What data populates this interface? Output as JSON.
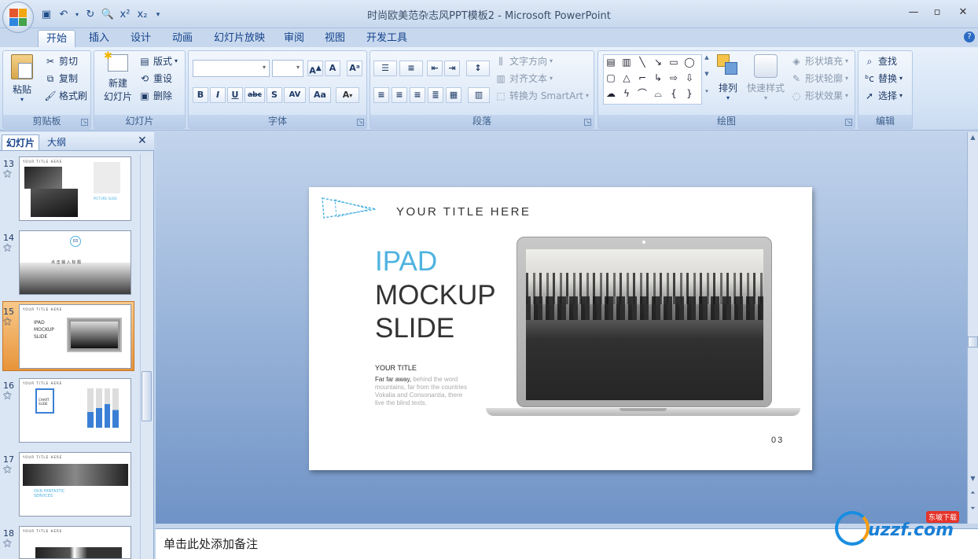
{
  "window": {
    "title": "时尚欧美范杂志风PPT模板2 - Microsoft PowerPoint"
  },
  "tabs": [
    "开始",
    "插入",
    "设计",
    "动画",
    "幻灯片放映",
    "审阅",
    "视图",
    "开发工具"
  ],
  "clipboard": {
    "paste": "粘贴",
    "cut": "剪切",
    "copy": "复制",
    "format_painter": "格式刷",
    "label": "剪贴板"
  },
  "slides_group": {
    "new_slide": "新建",
    "new_slide2": "幻灯片",
    "layout": "版式",
    "reset": "重设",
    "delete": "删除",
    "label": "幻灯片"
  },
  "font_group": {
    "label": "字体"
  },
  "paragraph_group": {
    "text_direction": "文字方向",
    "align_text": "对齐文本",
    "smartart": "转换为 SmartArt",
    "label": "段落"
  },
  "drawing_group": {
    "arrange": "排列",
    "quick_styles": "快速样式",
    "shape_fill": "形状填充",
    "shape_outline": "形状轮廓",
    "shape_effects": "形状效果",
    "label": "绘图"
  },
  "editing_group": {
    "find": "查找",
    "replace": "替换",
    "select": "选择",
    "label": "编辑"
  },
  "pane_tabs": {
    "slides": "幻灯片",
    "outline": "大纲"
  },
  "thumbnails": [
    {
      "num": "13",
      "title": "YOUR TITLE HERE",
      "caption": "PICTURE SLIDE"
    },
    {
      "num": "14",
      "title": "03",
      "caption": "点 击 输 入 标 题"
    },
    {
      "num": "15",
      "title": "YOUR TITLE HERE",
      "caption": "IPAD MOCKUP SLIDE"
    },
    {
      "num": "16",
      "title": "YOUR TITLE HERE",
      "caption": "CHART SLIDE"
    },
    {
      "num": "17",
      "title": "YOUR TITLE HERE",
      "caption": "OUR FANTASTIC SERVICES"
    },
    {
      "num": "18",
      "title": "YOUR TITLE HERE",
      "caption": ""
    }
  ],
  "slide": {
    "header": "YOUR TITLE HERE",
    "title_line1": "IPAD",
    "title_line2": "MOCKUP",
    "title_line3": "SLIDE",
    "subtitle": "YOUR TITLE",
    "body_lead": "Far far away,",
    "body_rest": " behind the word mountains, far from the countries Vokalia and Consonantia, there live the blind texts.",
    "page_number": "03"
  },
  "notes": {
    "placeholder": "单击此处添加备注"
  },
  "watermark": {
    "text": "uzzf.com",
    "sub": "东坡下载"
  },
  "colors": {
    "accent_blue": "#4fb3e0",
    "ribbon": "#dbe7f6",
    "selection": "#f4b25e"
  }
}
